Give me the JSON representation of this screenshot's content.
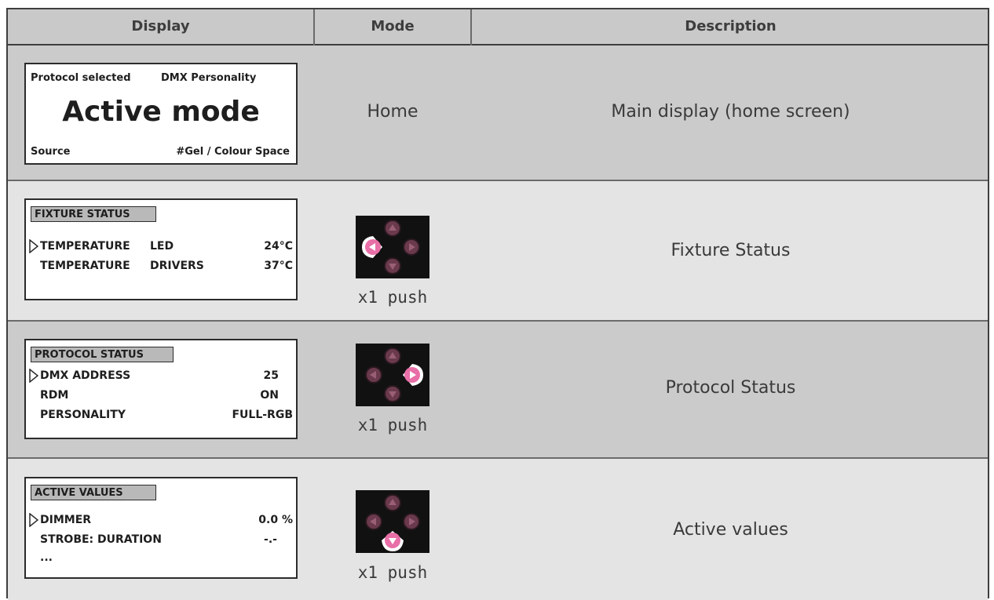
{
  "header": {
    "display": "Display",
    "mode": "Mode",
    "description": "Description"
  },
  "rows": [
    {
      "mode": "Home",
      "description": "Main display (home screen)",
      "screen": {
        "top_left": "Protocol selected",
        "top_right": "DMX Personality",
        "big": "Active mode",
        "bottom_left": "Source",
        "bottom_right": "#Gel / Colour Space"
      }
    },
    {
      "push": "x1 push",
      "active_button": "left",
      "description": "Fixture Status",
      "screen": {
        "tab": "FIXTURE STATUS",
        "lines": [
          {
            "label": "TEMPERATURE",
            "sub": "LED",
            "value": "24°C"
          },
          {
            "label": "TEMPERATURE",
            "sub": "DRIVERS",
            "value": "37°C"
          }
        ]
      }
    },
    {
      "push": "x1 push",
      "active_button": "right",
      "description": "Protocol Status",
      "screen": {
        "tab": "PROTOCOL STATUS",
        "lines": [
          {
            "label": "DMX ADDRESS",
            "value": "25"
          },
          {
            "label": "RDM",
            "value": "ON"
          },
          {
            "label": "PERSONALITY",
            "value": "FULL-RGB"
          }
        ]
      }
    },
    {
      "push": "x1 push",
      "active_button": "down",
      "description": "Active values",
      "screen": {
        "tab": "ACTIVE VALUES",
        "lines": [
          {
            "label": "DIMMER",
            "value": "0.0 %"
          },
          {
            "label": "STROBE: DURATION",
            "value": "-.-"
          },
          {
            "label": "..."
          }
        ]
      }
    }
  ],
  "colors": {
    "row_dark": "#cbcbcb",
    "row_light": "#e4e4e4",
    "header": "#c9c9c9",
    "button_active": "#e86fa7",
    "button_inactive": "#6a3a4c"
  }
}
